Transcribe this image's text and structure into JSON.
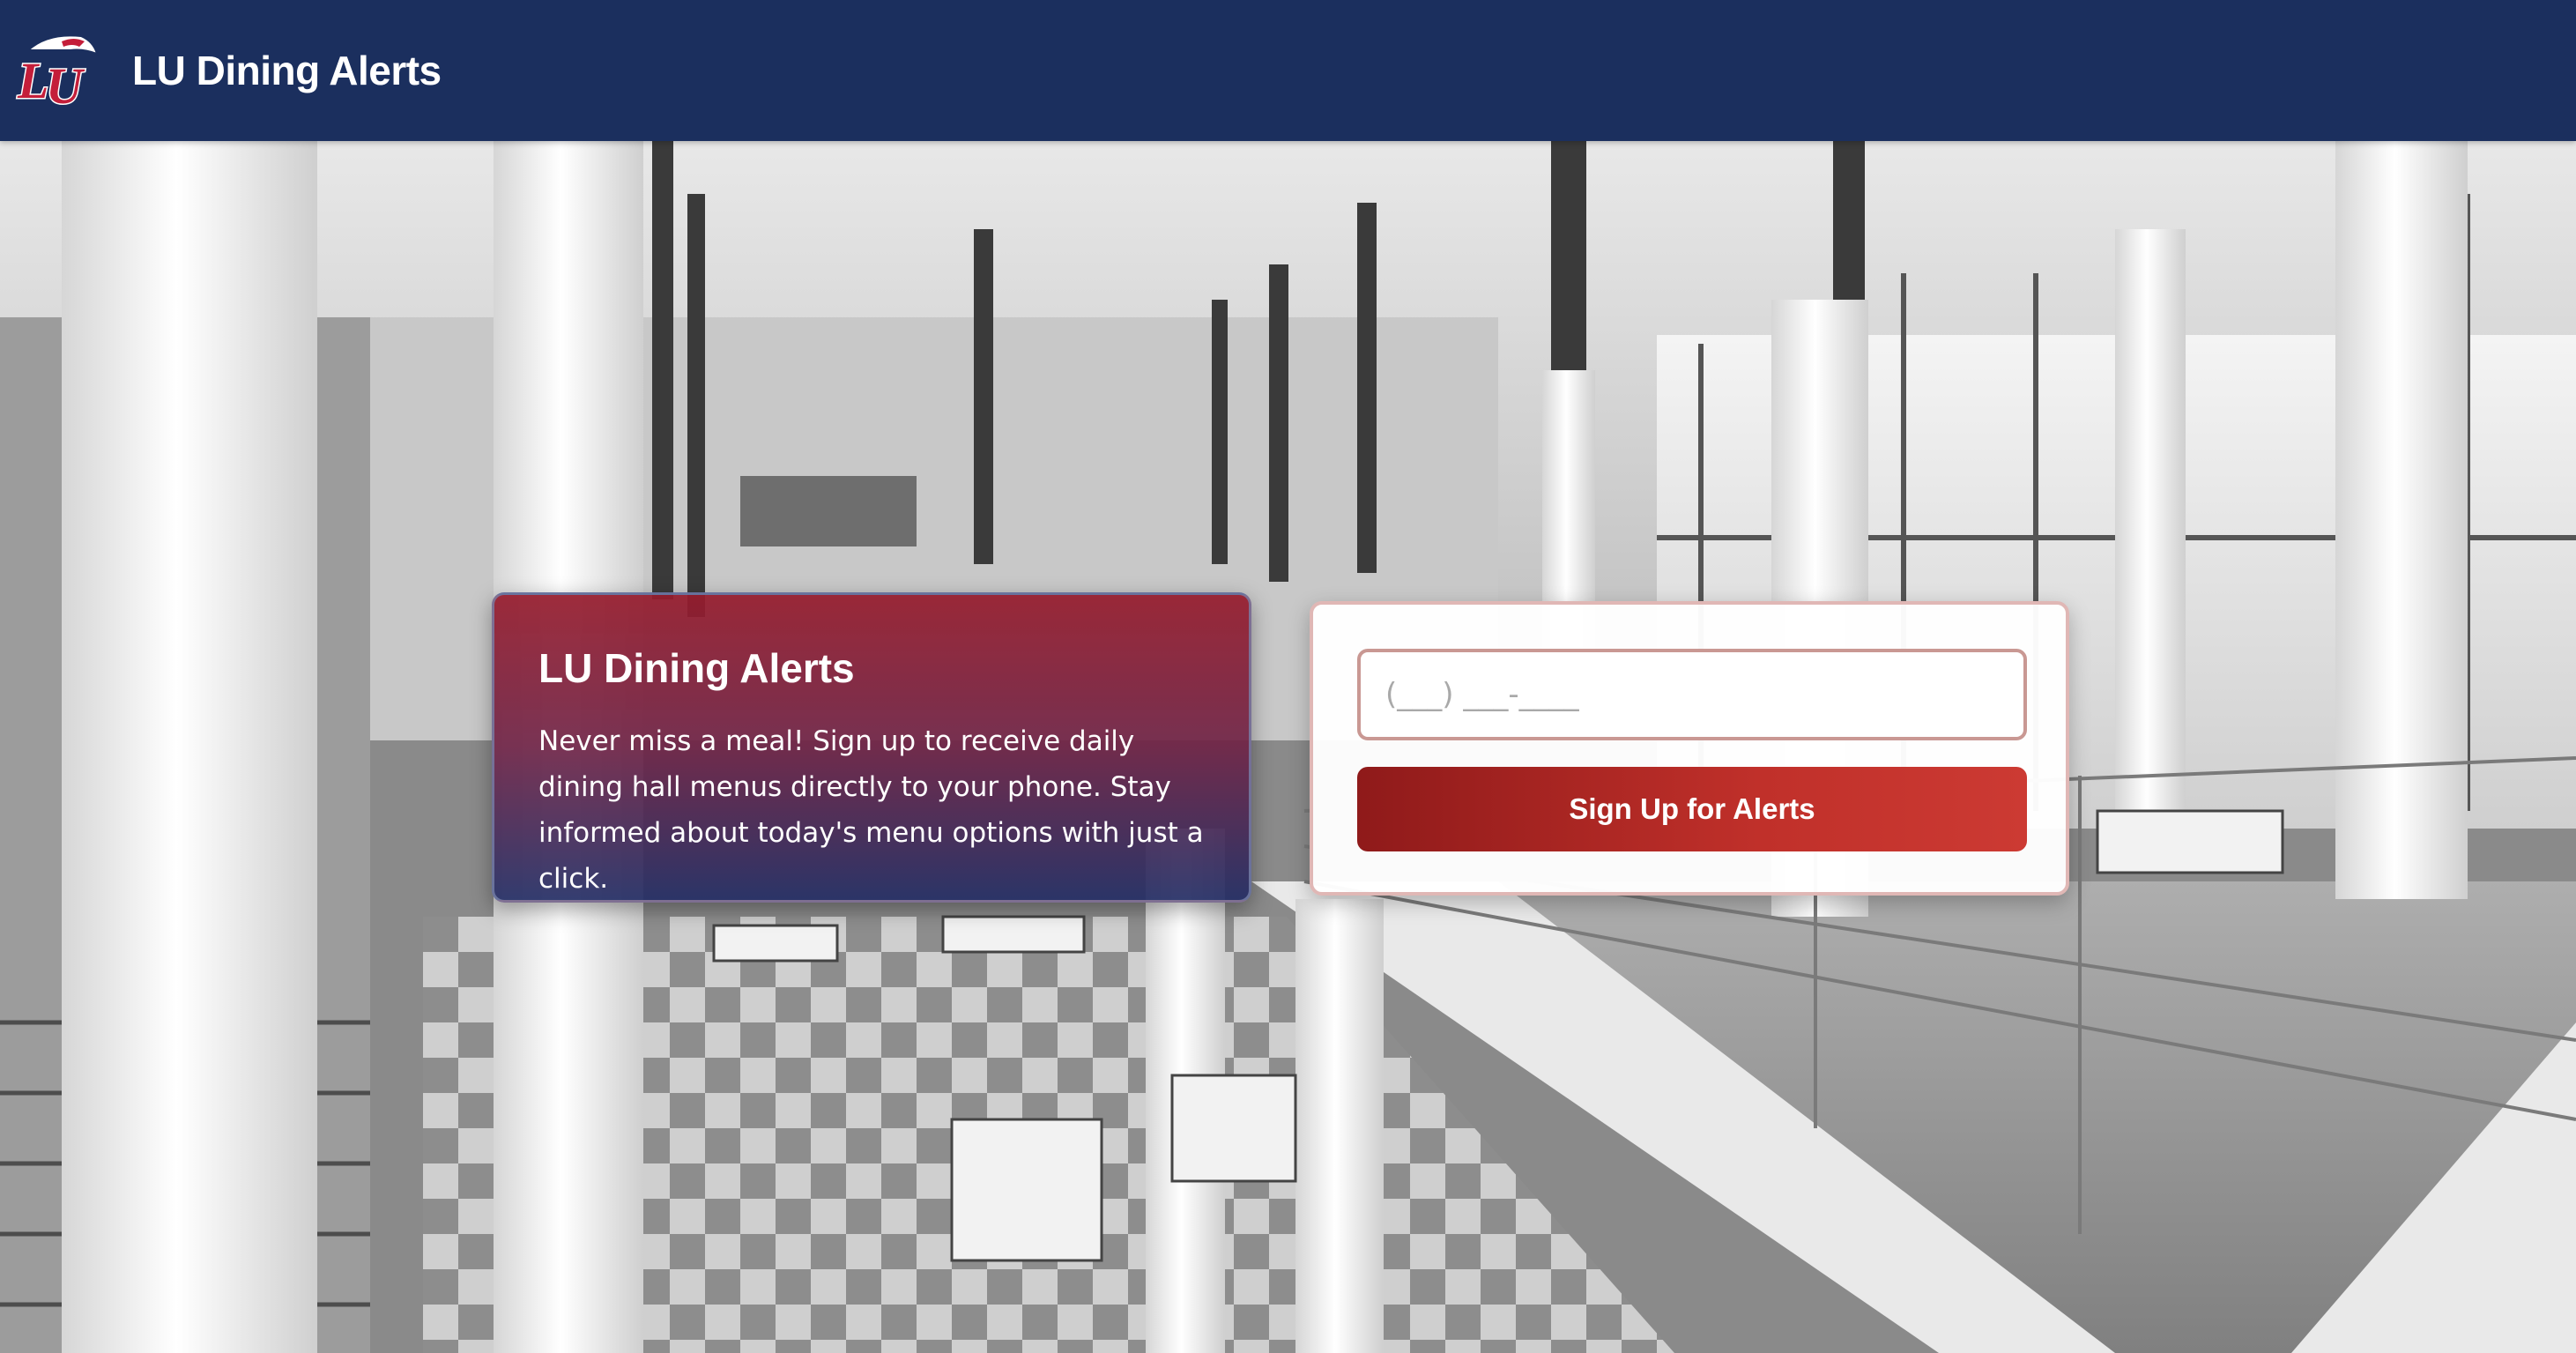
{
  "header": {
    "title": "LU Dining Alerts",
    "logo_icon": "liberty-flames-eagle-logo"
  },
  "info": {
    "title": "LU Dining Alerts",
    "description": "Never miss a meal! Sign up to receive daily dining hall menus directly to your phone. Stay informed about today's menu options with just a click."
  },
  "form": {
    "phone_placeholder": "(___) ___-____",
    "phone_value": "",
    "submit_label": "Sign Up for Alerts"
  },
  "colors": {
    "header_bg": "#1b2f5e",
    "brand_red": "#c0302a",
    "brand_navy": "#1b2f5e"
  }
}
